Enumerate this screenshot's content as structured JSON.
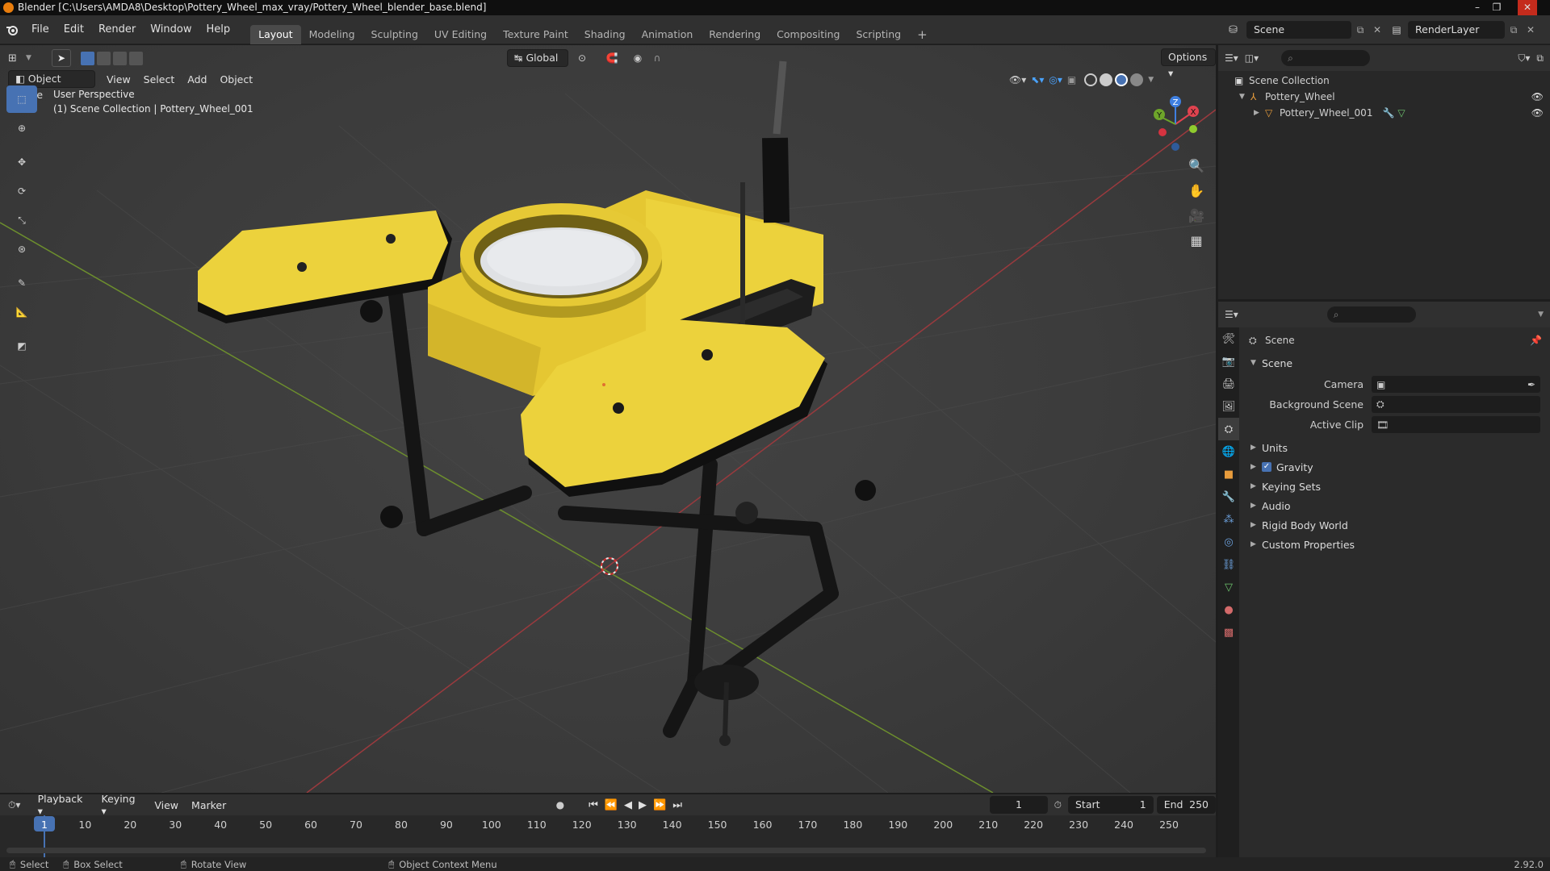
{
  "window": {
    "title": "Blender [C:\\Users\\AMDA8\\Desktop\\Pottery_Wheel_max_vray/Pottery_Wheel_blender_base.blend]",
    "controls": [
      "–",
      "❐",
      "✕"
    ]
  },
  "menubar": {
    "menus": [
      "File",
      "Edit",
      "Render",
      "Window",
      "Help"
    ],
    "workspaces": [
      "Layout",
      "Modeling",
      "Sculpting",
      "UV Editing",
      "Texture Paint",
      "Shading",
      "Animation",
      "Rendering",
      "Compositing",
      "Scripting"
    ],
    "active_workspace": "Layout",
    "add_workspace": "+",
    "scene_name": "Scene",
    "render_layer": "RenderLayer"
  },
  "viewport": {
    "mode": "Object Mode",
    "menus": [
      "View",
      "Select",
      "Add",
      "Object"
    ],
    "transform_orientation": "Global",
    "options_label": "Options",
    "overlay_line1": "User Perspective",
    "overlay_line2": "(1) Scene Collection | Pottery_Wheel_001",
    "axes": {
      "x": "X",
      "y": "Y",
      "z": "Z"
    },
    "colors": {
      "x": "#e0434f",
      "y": "#6ea52a",
      "z": "#3f7fe0",
      "model_yellow": "#ecd23c"
    }
  },
  "outliner": {
    "root": "Scene Collection",
    "items": [
      {
        "label": "Pottery_Wheel"
      },
      {
        "label": "Pottery_Wheel_001"
      }
    ]
  },
  "properties": {
    "context": "Scene",
    "panel_title": "Scene",
    "fields": [
      {
        "label": "Camera"
      },
      {
        "label": "Background Scene"
      },
      {
        "label": "Active Clip"
      }
    ],
    "panels": [
      "Units",
      "Gravity",
      "Keying Sets",
      "Audio",
      "Rigid Body World",
      "Custom Properties"
    ]
  },
  "timeline": {
    "menus": [
      "Playback",
      "Keying",
      "View",
      "Marker"
    ],
    "current_frame": "1",
    "start_label": "Start",
    "start": "1",
    "end_label": "End",
    "end": "250",
    "ticks": [
      "1",
      "10",
      "20",
      "30",
      "40",
      "50",
      "60",
      "70",
      "80",
      "90",
      "100",
      "110",
      "120",
      "130",
      "140",
      "150",
      "160",
      "170",
      "180",
      "190",
      "200",
      "210",
      "220",
      "230",
      "240",
      "250"
    ]
  },
  "statusbar": {
    "select": "Select",
    "box_select": "Box Select",
    "rotate_view": "Rotate View",
    "context_menu": "Object Context Menu",
    "version": "2.92.0"
  }
}
